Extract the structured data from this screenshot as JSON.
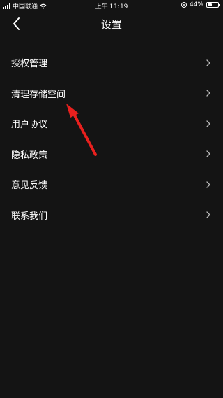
{
  "status_bar": {
    "carrier": "中国联通",
    "time": "上午 11:19",
    "battery": "44%",
    "battery_level": 0.44
  },
  "header": {
    "title": "设置",
    "back_icon": "chevron-left-icon"
  },
  "menu": {
    "items": [
      {
        "label": "授权管理",
        "icon": "chevron-right-icon"
      },
      {
        "label": "清理存储空间",
        "icon": "chevron-right-icon"
      },
      {
        "label": "用户协议",
        "icon": "chevron-right-icon"
      },
      {
        "label": "隐私政策",
        "icon": "chevron-right-icon"
      },
      {
        "label": "意见反馈",
        "icon": "chevron-right-icon"
      },
      {
        "label": "联系我们",
        "icon": "chevron-right-icon"
      }
    ]
  },
  "colors": {
    "background": "#141414",
    "text": "#ffffff",
    "chevron": "#bbbbbb",
    "annotation": "#e8201e"
  }
}
